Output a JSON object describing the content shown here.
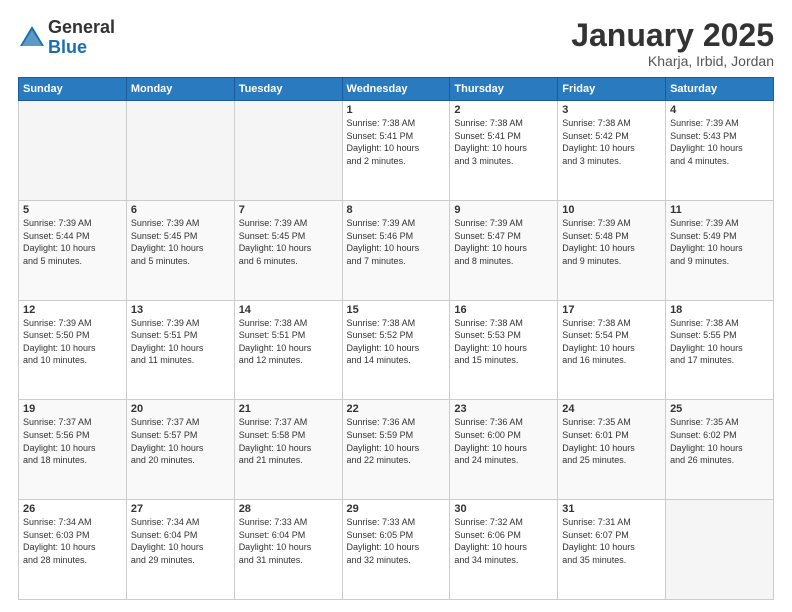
{
  "header": {
    "logo_general": "General",
    "logo_blue": "Blue",
    "month": "January 2025",
    "location": "Kharja, Irbid, Jordan"
  },
  "weekdays": [
    "Sunday",
    "Monday",
    "Tuesday",
    "Wednesday",
    "Thursday",
    "Friday",
    "Saturday"
  ],
  "weeks": [
    [
      {
        "day": "",
        "info": ""
      },
      {
        "day": "",
        "info": ""
      },
      {
        "day": "",
        "info": ""
      },
      {
        "day": "1",
        "info": "Sunrise: 7:38 AM\nSunset: 5:41 PM\nDaylight: 10 hours\nand 2 minutes."
      },
      {
        "day": "2",
        "info": "Sunrise: 7:38 AM\nSunset: 5:41 PM\nDaylight: 10 hours\nand 3 minutes."
      },
      {
        "day": "3",
        "info": "Sunrise: 7:38 AM\nSunset: 5:42 PM\nDaylight: 10 hours\nand 3 minutes."
      },
      {
        "day": "4",
        "info": "Sunrise: 7:39 AM\nSunset: 5:43 PM\nDaylight: 10 hours\nand 4 minutes."
      }
    ],
    [
      {
        "day": "5",
        "info": "Sunrise: 7:39 AM\nSunset: 5:44 PM\nDaylight: 10 hours\nand 5 minutes."
      },
      {
        "day": "6",
        "info": "Sunrise: 7:39 AM\nSunset: 5:45 PM\nDaylight: 10 hours\nand 5 minutes."
      },
      {
        "day": "7",
        "info": "Sunrise: 7:39 AM\nSunset: 5:45 PM\nDaylight: 10 hours\nand 6 minutes."
      },
      {
        "day": "8",
        "info": "Sunrise: 7:39 AM\nSunset: 5:46 PM\nDaylight: 10 hours\nand 7 minutes."
      },
      {
        "day": "9",
        "info": "Sunrise: 7:39 AM\nSunset: 5:47 PM\nDaylight: 10 hours\nand 8 minutes."
      },
      {
        "day": "10",
        "info": "Sunrise: 7:39 AM\nSunset: 5:48 PM\nDaylight: 10 hours\nand 9 minutes."
      },
      {
        "day": "11",
        "info": "Sunrise: 7:39 AM\nSunset: 5:49 PM\nDaylight: 10 hours\nand 9 minutes."
      }
    ],
    [
      {
        "day": "12",
        "info": "Sunrise: 7:39 AM\nSunset: 5:50 PM\nDaylight: 10 hours\nand 10 minutes."
      },
      {
        "day": "13",
        "info": "Sunrise: 7:39 AM\nSunset: 5:51 PM\nDaylight: 10 hours\nand 11 minutes."
      },
      {
        "day": "14",
        "info": "Sunrise: 7:38 AM\nSunset: 5:51 PM\nDaylight: 10 hours\nand 12 minutes."
      },
      {
        "day": "15",
        "info": "Sunrise: 7:38 AM\nSunset: 5:52 PM\nDaylight: 10 hours\nand 14 minutes."
      },
      {
        "day": "16",
        "info": "Sunrise: 7:38 AM\nSunset: 5:53 PM\nDaylight: 10 hours\nand 15 minutes."
      },
      {
        "day": "17",
        "info": "Sunrise: 7:38 AM\nSunset: 5:54 PM\nDaylight: 10 hours\nand 16 minutes."
      },
      {
        "day": "18",
        "info": "Sunrise: 7:38 AM\nSunset: 5:55 PM\nDaylight: 10 hours\nand 17 minutes."
      }
    ],
    [
      {
        "day": "19",
        "info": "Sunrise: 7:37 AM\nSunset: 5:56 PM\nDaylight: 10 hours\nand 18 minutes."
      },
      {
        "day": "20",
        "info": "Sunrise: 7:37 AM\nSunset: 5:57 PM\nDaylight: 10 hours\nand 20 minutes."
      },
      {
        "day": "21",
        "info": "Sunrise: 7:37 AM\nSunset: 5:58 PM\nDaylight: 10 hours\nand 21 minutes."
      },
      {
        "day": "22",
        "info": "Sunrise: 7:36 AM\nSunset: 5:59 PM\nDaylight: 10 hours\nand 22 minutes."
      },
      {
        "day": "23",
        "info": "Sunrise: 7:36 AM\nSunset: 6:00 PM\nDaylight: 10 hours\nand 24 minutes."
      },
      {
        "day": "24",
        "info": "Sunrise: 7:35 AM\nSunset: 6:01 PM\nDaylight: 10 hours\nand 25 minutes."
      },
      {
        "day": "25",
        "info": "Sunrise: 7:35 AM\nSunset: 6:02 PM\nDaylight: 10 hours\nand 26 minutes."
      }
    ],
    [
      {
        "day": "26",
        "info": "Sunrise: 7:34 AM\nSunset: 6:03 PM\nDaylight: 10 hours\nand 28 minutes."
      },
      {
        "day": "27",
        "info": "Sunrise: 7:34 AM\nSunset: 6:04 PM\nDaylight: 10 hours\nand 29 minutes."
      },
      {
        "day": "28",
        "info": "Sunrise: 7:33 AM\nSunset: 6:04 PM\nDaylight: 10 hours\nand 31 minutes."
      },
      {
        "day": "29",
        "info": "Sunrise: 7:33 AM\nSunset: 6:05 PM\nDaylight: 10 hours\nand 32 minutes."
      },
      {
        "day": "30",
        "info": "Sunrise: 7:32 AM\nSunset: 6:06 PM\nDaylight: 10 hours\nand 34 minutes."
      },
      {
        "day": "31",
        "info": "Sunrise: 7:31 AM\nSunset: 6:07 PM\nDaylight: 10 hours\nand 35 minutes."
      },
      {
        "day": "",
        "info": ""
      }
    ]
  ]
}
